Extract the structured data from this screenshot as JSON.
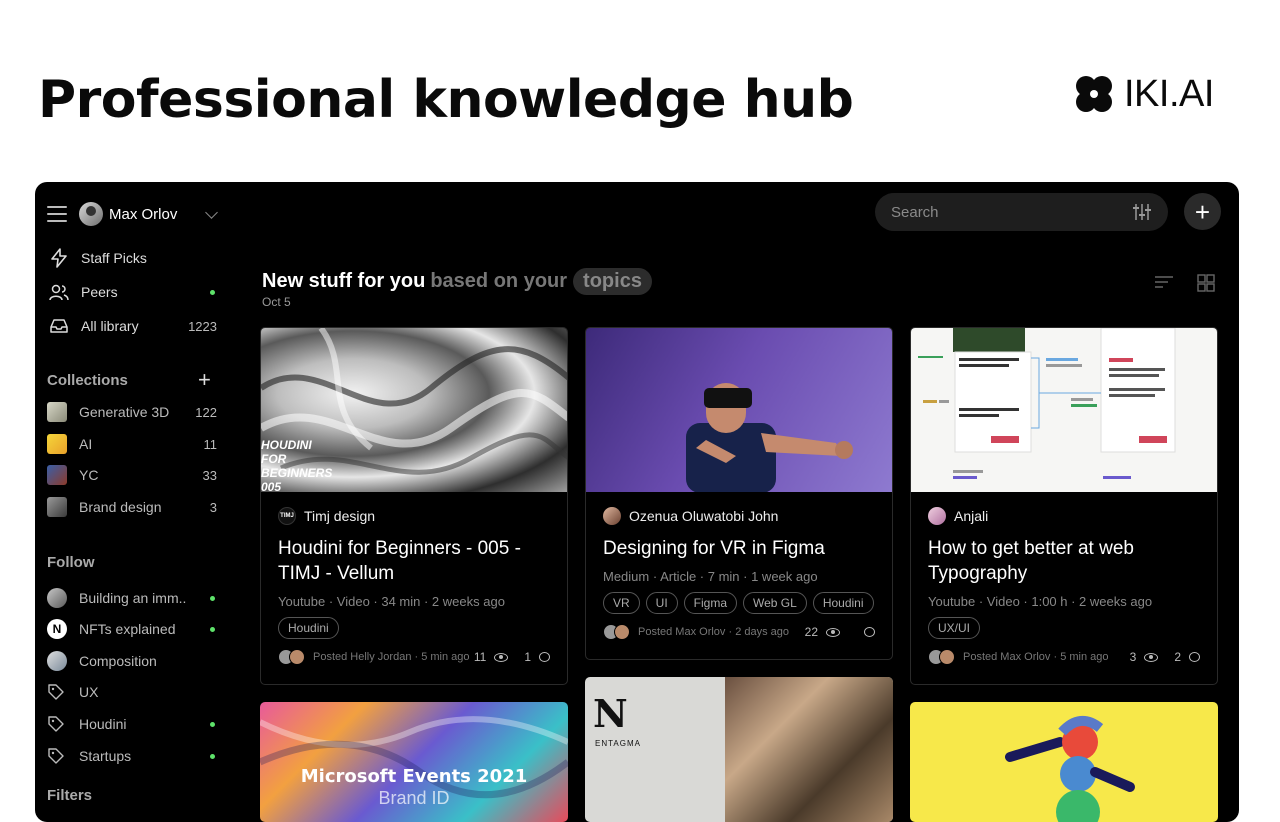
{
  "header": {
    "title": "Professional knowledge hub",
    "brand": "IKI.AI"
  },
  "sidebar": {
    "user": "Max Orlov",
    "nav": [
      {
        "label": "Staff Picks",
        "icon": "bolt-icon"
      },
      {
        "label": "Peers",
        "icon": "users-icon",
        "indicator": "new"
      },
      {
        "label": "All library",
        "icon": "inbox-icon",
        "count": "1223"
      }
    ],
    "collections_title": "Collections",
    "collections": [
      {
        "label": "Generative 3D",
        "count": "122"
      },
      {
        "label": "AI",
        "count": "11"
      },
      {
        "label": "YC",
        "count": "33"
      },
      {
        "label": "Brand design",
        "count": "3"
      }
    ],
    "follow_title": "Follow",
    "follow": [
      {
        "label": "Building an imm..",
        "indicator": "new"
      },
      {
        "label": "NFTs explained",
        "indicator": "new"
      },
      {
        "label": "Composition"
      },
      {
        "label": "UX"
      },
      {
        "label": "Houdini",
        "indicator": "new"
      },
      {
        "label": "Startups",
        "indicator": "new"
      }
    ],
    "filters_title": "Filters"
  },
  "search": {
    "placeholder": "Search"
  },
  "feed": {
    "heading": "New stuff for you",
    "heading_muted": "based on your",
    "heading_pill": "topics",
    "date": "Oct 5"
  },
  "cards": [
    {
      "author": "Timj design",
      "author_badge": "TIMJ",
      "title": "Houdini for Beginners - 005 - TIMJ - Vellum",
      "meta": "Youtube · Video · 34 min · 2 weeks ago",
      "tags": [
        "Houdini"
      ],
      "posted": "Posted Helly Jordan · 5 min ago",
      "views": "11",
      "comments": "1",
      "image_text": "HOUDINI FOR BEGINNERS 005"
    },
    {
      "author": "Ozenua Oluwatobi John",
      "title": "Designing for VR in Figma",
      "meta": "Medium · Article · 7 min · 1 week ago",
      "tags": [
        "VR",
        "UI",
        "Figma",
        "Web GL",
        "Houdini"
      ],
      "posted": "Posted Max Orlov · 2 days ago",
      "views": "22",
      "comments": ""
    },
    {
      "author": "Anjali",
      "title": "How to get better at web Typography",
      "meta": "Youtube · Video · 1:00 h · 2 weeks ago",
      "tags": [
        "UX/UI"
      ],
      "posted": "Posted Max Orlov · 5 min ago",
      "views": "3",
      "comments": "2"
    }
  ],
  "row2": [
    {
      "image_title": "Microsoft Events 2021",
      "image_subtitle": "Brand ID"
    },
    {
      "image_brand": "ENTAGMA",
      "image_letter": "N"
    },
    {}
  ],
  "colors": {
    "accent_green": "#5ee26a",
    "app_bg": "#000000",
    "search_bg": "#1e1e1e"
  }
}
